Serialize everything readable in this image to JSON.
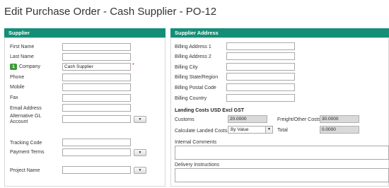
{
  "page": {
    "title": "Edit Purchase Order - Cash Supplier - PO-12"
  },
  "supplier": {
    "header": "Supplier",
    "badge": "1",
    "required_marker": "*",
    "dropdown_glyph": "▼",
    "fields": {
      "first_name": {
        "label": "First Name",
        "value": ""
      },
      "last_name": {
        "label": "Last Name",
        "value": ""
      },
      "company": {
        "label": "Company",
        "value": "Cash Supplier"
      },
      "phone": {
        "label": "Phone",
        "value": ""
      },
      "mobile": {
        "label": "Mobile",
        "value": ""
      },
      "fax": {
        "label": "Fax",
        "value": ""
      },
      "email": {
        "label": "Email Address",
        "value": ""
      },
      "alt_gl": {
        "label_line1": "Alternative GL",
        "label_line2": "Account",
        "value": ""
      },
      "tracking": {
        "label": "Tracking Code",
        "value": ""
      },
      "payment_terms": {
        "label": "Payment Terms",
        "value": ""
      },
      "project_name": {
        "label": "Project Name",
        "value": ""
      }
    }
  },
  "supplier_address": {
    "header": "Supplier Address",
    "fields": {
      "billing_address_1": {
        "label": "Billing Address 1",
        "value": ""
      },
      "billing_address_2": {
        "label": "Billing Address 2",
        "value": ""
      },
      "billing_city": {
        "label": "Billing City",
        "value": ""
      },
      "billing_state": {
        "label": "Billing State/Region",
        "value": ""
      },
      "billing_postal": {
        "label": "Billing Postal Code",
        "value": ""
      },
      "billing_country": {
        "label": "Billing Country",
        "value": ""
      }
    }
  },
  "landing_costs": {
    "heading": "Landing Costs USD Excl GST",
    "customs": {
      "label": "Customs",
      "value": "20.0000"
    },
    "freight": {
      "label": "Freight/Other Costs",
      "value": "30.0000"
    },
    "calculate": {
      "label": "Calculate Landed Costs",
      "value": "By Value",
      "arrow": "▼"
    },
    "total": {
      "label": "Total",
      "value": "0.0000"
    }
  },
  "internal_comments": {
    "label": "Internal Comments",
    "value": ""
  },
  "delivery_instructions": {
    "label": "Delivery Instructions",
    "value": ""
  }
}
